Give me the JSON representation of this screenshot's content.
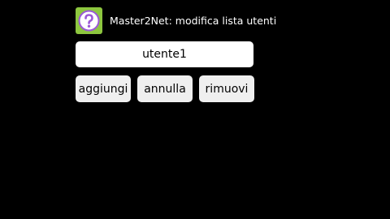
{
  "dialog": {
    "title": "Master2Net: modifica lista utenti",
    "icon": "question-mark-icon",
    "icon_bg": "#8dc63f",
    "icon_accent": "#9b59d6"
  },
  "user_field": {
    "value": "utente1"
  },
  "buttons": {
    "add_label": "aggiungi",
    "cancel_label": "annulla",
    "remove_label": "rimuovi"
  },
  "colors": {
    "background": "#000000",
    "field_background": "#ffffff",
    "button_background": "#efefef"
  }
}
